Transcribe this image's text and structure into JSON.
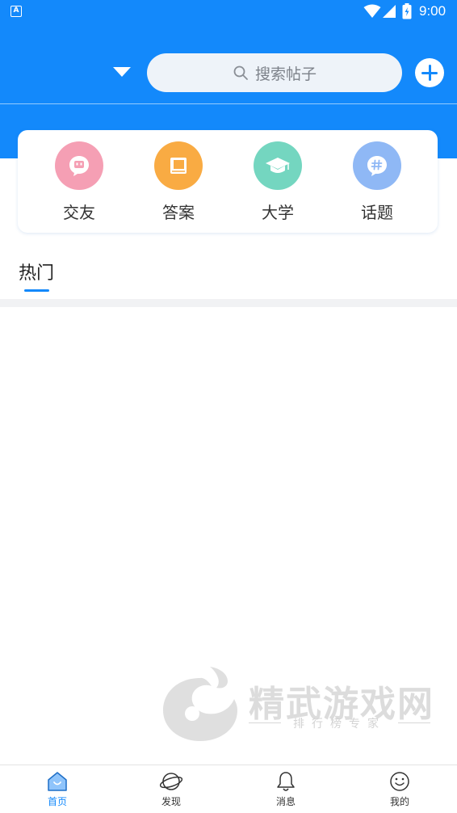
{
  "status_bar": {
    "app_badge": "A",
    "time": "9:00"
  },
  "toolbar": {
    "search_placeholder": "搜索帖子"
  },
  "categories": [
    {
      "label": "交友",
      "icon": "chat-bubble-icon",
      "color": "#f59fb4"
    },
    {
      "label": "答案",
      "icon": "book-icon",
      "color": "#f9ab43"
    },
    {
      "label": "大学",
      "icon": "graduation-cap-icon",
      "color": "#74d6c0"
    },
    {
      "label": "话题",
      "icon": "hashtag-icon",
      "color": "#8fb8f5"
    }
  ],
  "tabs": {
    "hot": "热门"
  },
  "watermark": {
    "title": "精武游戏网",
    "subtitle": "排行榜专家"
  },
  "bottom_nav": [
    {
      "label": "首页",
      "icon": "home-icon",
      "active": true
    },
    {
      "label": "发现",
      "icon": "planet-icon",
      "active": false
    },
    {
      "label": "消息",
      "icon": "bell-icon",
      "active": false
    },
    {
      "label": "我的",
      "icon": "smiley-icon",
      "active": false
    }
  ],
  "colors": {
    "primary": "#1389fb",
    "search_bg": "#eef3f9"
  }
}
